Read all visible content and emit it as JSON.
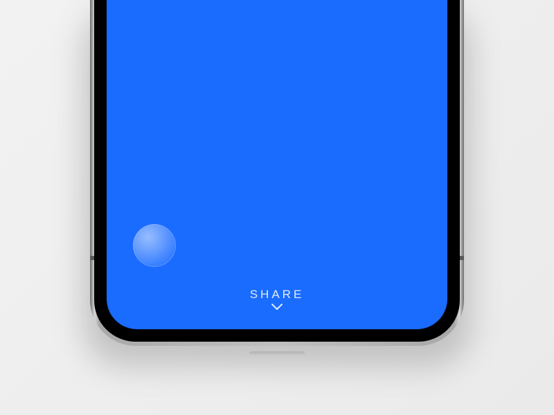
{
  "colors": {
    "screen_bg": "#1a6cff",
    "share_text": "rgba(255,255,255,0.88)",
    "page_bg": "#efefef"
  },
  "share": {
    "label": "SHARE"
  },
  "icons": {
    "chevron": "chevron-down-icon",
    "touch": "touch-indicator"
  }
}
